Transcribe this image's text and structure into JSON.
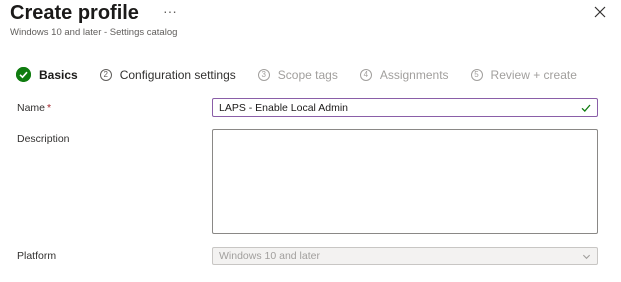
{
  "header": {
    "title": "Create profile",
    "more_label": "···",
    "subtitle": "Windows 10 and later - Settings catalog"
  },
  "steps": [
    {
      "number": "✓",
      "label": "Basics",
      "state": "completed"
    },
    {
      "number": "2",
      "label": "Configuration settings",
      "state": "upcoming"
    },
    {
      "number": "3",
      "label": "Scope tags",
      "state": "disabled"
    },
    {
      "number": "4",
      "label": "Assignments",
      "state": "disabled"
    },
    {
      "number": "5",
      "label": "Review + create",
      "state": "disabled"
    }
  ],
  "form": {
    "name_label": "Name",
    "required_mark": "*",
    "name_value": "LAPS - Enable Local Admin",
    "description_label": "Description",
    "description_value": "",
    "platform_label": "Platform",
    "platform_value": "Windows 10 and later"
  },
  "icons": {
    "close": "close-icon",
    "check": "checkmark-icon",
    "chevron": "chevron-down-icon"
  },
  "colors": {
    "accent_purple": "#8a5ea8",
    "success_green": "#107c10",
    "required_red": "#a4262c"
  }
}
